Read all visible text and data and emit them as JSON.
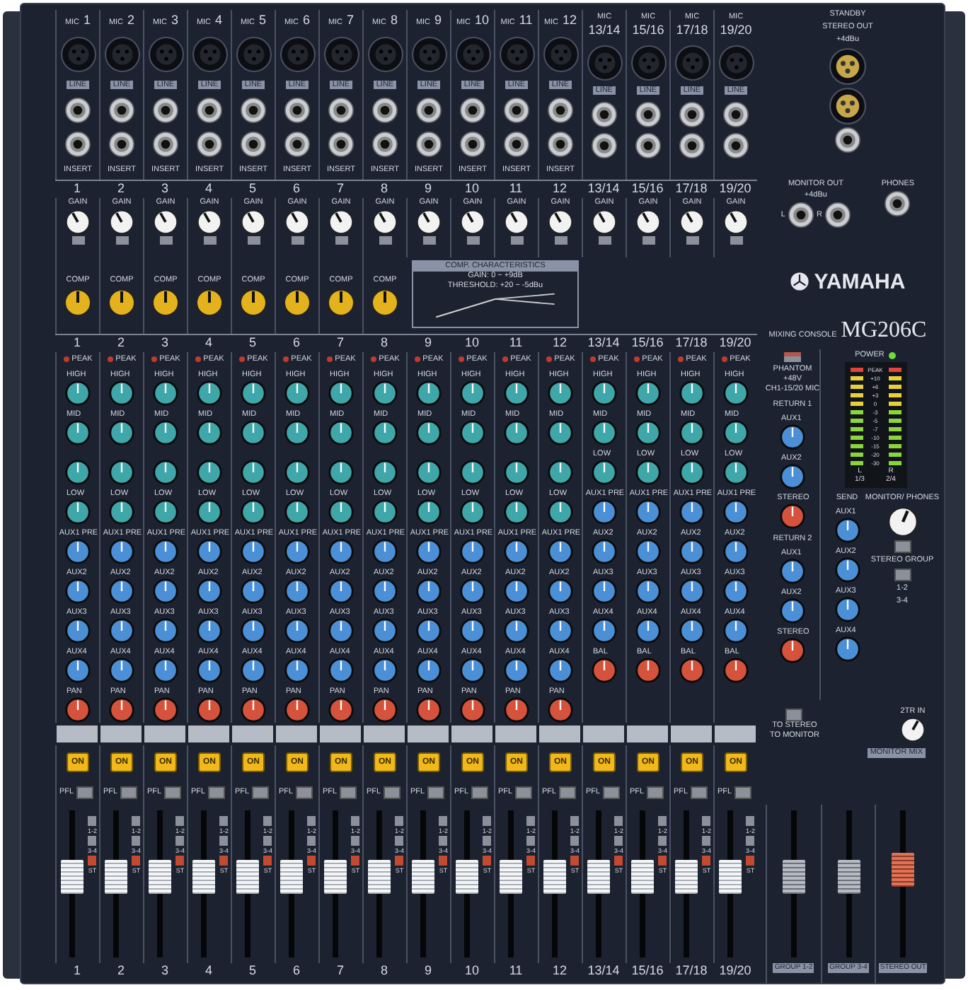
{
  "channels": [
    {
      "numbers": [
        "1",
        "1",
        "1",
        "1"
      ],
      "mic": "MIC",
      "line": "LINE",
      "insert": "INSERT",
      "gain": "GAIN",
      "comp": "COMP",
      "peak": "PEAK",
      "knobs": [
        {
          "label": "HIGH",
          "color": "#3fa6a9"
        },
        {
          "label": "MID",
          "color": "#3fa6a9"
        },
        {
          "color": "#3fa6a9"
        },
        {
          "label": "LOW",
          "color": "#3fa6a9"
        },
        {
          "label": "AUX1 PRE",
          "color": "#4b8fd6"
        },
        {
          "label": "AUX2",
          "color": "#4b8fd6"
        },
        {
          "label": "AUX3",
          "color": "#4b8fd6"
        },
        {
          "label": "AUX4",
          "color": "#4b8fd6"
        },
        {
          "label": "PAN",
          "color": "#d5523c"
        }
      ],
      "on": "ON",
      "pfl": "PFL",
      "assign": [
        "1-2",
        "3-4",
        "ST"
      ],
      "level": 0.56
    },
    {
      "numbers": [
        "2",
        "2",
        "2",
        "2"
      ],
      "mic": "MIC",
      "line": "LINE",
      "insert": "INSERT",
      "gain": "GAIN",
      "comp": "COMP",
      "peak": "PEAK",
      "knobs": [
        {
          "label": "HIGH",
          "color": "#3fa6a9"
        },
        {
          "label": "MID",
          "color": "#3fa6a9"
        },
        {
          "color": "#3fa6a9"
        },
        {
          "label": "LOW",
          "color": "#3fa6a9"
        },
        {
          "label": "AUX1 PRE",
          "color": "#4b8fd6"
        },
        {
          "label": "AUX2",
          "color": "#4b8fd6"
        },
        {
          "label": "AUX3",
          "color": "#4b8fd6"
        },
        {
          "label": "AUX4",
          "color": "#4b8fd6"
        },
        {
          "label": "PAN",
          "color": "#d5523c"
        }
      ],
      "on": "ON",
      "pfl": "PFL",
      "assign": [
        "1-2",
        "3-4",
        "ST"
      ],
      "level": 0.56
    },
    {
      "numbers": [
        "3",
        "3",
        "3",
        "3"
      ],
      "mic": "MIC",
      "line": "LINE",
      "insert": "INSERT",
      "gain": "GAIN",
      "comp": "COMP",
      "peak": "PEAK",
      "knobs": [
        {
          "label": "HIGH",
          "color": "#3fa6a9"
        },
        {
          "label": "MID",
          "color": "#3fa6a9"
        },
        {
          "color": "#3fa6a9"
        },
        {
          "label": "LOW",
          "color": "#3fa6a9"
        },
        {
          "label": "AUX1 PRE",
          "color": "#4b8fd6"
        },
        {
          "label": "AUX2",
          "color": "#4b8fd6"
        },
        {
          "label": "AUX3",
          "color": "#4b8fd6"
        },
        {
          "label": "AUX4",
          "color": "#4b8fd6"
        },
        {
          "label": "PAN",
          "color": "#d5523c"
        }
      ],
      "on": "ON",
      "pfl": "PFL",
      "assign": [
        "1-2",
        "3-4",
        "ST"
      ],
      "level": 0.56
    },
    {
      "numbers": [
        "4",
        "4",
        "4",
        "4"
      ],
      "mic": "MIC",
      "line": "LINE",
      "insert": "INSERT",
      "gain": "GAIN",
      "comp": "COMP",
      "peak": "PEAK",
      "knobs": [
        {
          "label": "HIGH",
          "color": "#3fa6a9"
        },
        {
          "label": "MID",
          "color": "#3fa6a9"
        },
        {
          "color": "#3fa6a9"
        },
        {
          "label": "LOW",
          "color": "#3fa6a9"
        },
        {
          "label": "AUX1 PRE",
          "color": "#4b8fd6"
        },
        {
          "label": "AUX2",
          "color": "#4b8fd6"
        },
        {
          "label": "AUX3",
          "color": "#4b8fd6"
        },
        {
          "label": "AUX4",
          "color": "#4b8fd6"
        },
        {
          "label": "PAN",
          "color": "#d5523c"
        }
      ],
      "on": "ON",
      "pfl": "PFL",
      "assign": [
        "1-2",
        "3-4",
        "ST"
      ],
      "level": 0.56
    },
    {
      "numbers": [
        "5",
        "5",
        "5",
        "5"
      ],
      "mic": "MIC",
      "line": "LINE",
      "insert": "INSERT",
      "gain": "GAIN",
      "comp": "COMP",
      "peak": "PEAK",
      "knobs": [
        {
          "label": "HIGH",
          "color": "#3fa6a9"
        },
        {
          "label": "MID",
          "color": "#3fa6a9"
        },
        {
          "color": "#3fa6a9"
        },
        {
          "label": "LOW",
          "color": "#3fa6a9"
        },
        {
          "label": "AUX1 PRE",
          "color": "#4b8fd6"
        },
        {
          "label": "AUX2",
          "color": "#4b8fd6"
        },
        {
          "label": "AUX3",
          "color": "#4b8fd6"
        },
        {
          "label": "AUX4",
          "color": "#4b8fd6"
        },
        {
          "label": "PAN",
          "color": "#d5523c"
        }
      ],
      "on": "ON",
      "pfl": "PFL",
      "assign": [
        "1-2",
        "3-4",
        "ST"
      ],
      "level": 0.56
    },
    {
      "numbers": [
        "6",
        "6",
        "6",
        "6"
      ],
      "mic": "MIC",
      "line": "LINE",
      "insert": "INSERT",
      "gain": "GAIN",
      "comp": "COMP",
      "peak": "PEAK",
      "knobs": [
        {
          "label": "HIGH",
          "color": "#3fa6a9"
        },
        {
          "label": "MID",
          "color": "#3fa6a9"
        },
        {
          "color": "#3fa6a9"
        },
        {
          "label": "LOW",
          "color": "#3fa6a9"
        },
        {
          "label": "AUX1 PRE",
          "color": "#4b8fd6"
        },
        {
          "label": "AUX2",
          "color": "#4b8fd6"
        },
        {
          "label": "AUX3",
          "color": "#4b8fd6"
        },
        {
          "label": "AUX4",
          "color": "#4b8fd6"
        },
        {
          "label": "PAN",
          "color": "#d5523c"
        }
      ],
      "on": "ON",
      "pfl": "PFL",
      "assign": [
        "1-2",
        "3-4",
        "ST"
      ],
      "level": 0.56
    },
    {
      "numbers": [
        "7",
        "7",
        "7",
        "7"
      ],
      "mic": "MIC",
      "line": "LINE",
      "insert": "INSERT",
      "gain": "GAIN",
      "comp": "COMP",
      "peak": "PEAK",
      "knobs": [
        {
          "label": "HIGH",
          "color": "#3fa6a9"
        },
        {
          "label": "MID",
          "color": "#3fa6a9"
        },
        {
          "color": "#3fa6a9"
        },
        {
          "label": "LOW",
          "color": "#3fa6a9"
        },
        {
          "label": "AUX1 PRE",
          "color": "#4b8fd6"
        },
        {
          "label": "AUX2",
          "color": "#4b8fd6"
        },
        {
          "label": "AUX3",
          "color": "#4b8fd6"
        },
        {
          "label": "AUX4",
          "color": "#4b8fd6"
        },
        {
          "label": "PAN",
          "color": "#d5523c"
        }
      ],
      "on": "ON",
      "pfl": "PFL",
      "assign": [
        "1-2",
        "3-4",
        "ST"
      ],
      "level": 0.56
    },
    {
      "numbers": [
        "8",
        "8",
        "8",
        "8"
      ],
      "mic": "MIC",
      "line": "LINE",
      "insert": "INSERT",
      "gain": "GAIN",
      "comp": "COMP",
      "peak": "PEAK",
      "knobs": [
        {
          "label": "HIGH",
          "color": "#3fa6a9"
        },
        {
          "label": "MID",
          "color": "#3fa6a9"
        },
        {
          "color": "#3fa6a9"
        },
        {
          "label": "LOW",
          "color": "#3fa6a9"
        },
        {
          "label": "AUX1 PRE",
          "color": "#4b8fd6"
        },
        {
          "label": "AUX2",
          "color": "#4b8fd6"
        },
        {
          "label": "AUX3",
          "color": "#4b8fd6"
        },
        {
          "label": "AUX4",
          "color": "#4b8fd6"
        },
        {
          "label": "PAN",
          "color": "#d5523c"
        }
      ],
      "on": "ON",
      "pfl": "PFL",
      "assign": [
        "1-2",
        "3-4",
        "ST"
      ],
      "level": 0.56
    },
    {
      "numbers": [
        "9",
        "9",
        "9",
        "9"
      ],
      "mic": "MIC",
      "line": "LINE",
      "insert": "INSERT",
      "gain": "GAIN",
      "peak": "PEAK",
      "knobs": [
        {
          "label": "HIGH",
          "color": "#3fa6a9"
        },
        {
          "label": "MID",
          "color": "#3fa6a9"
        },
        {
          "color": "#3fa6a9"
        },
        {
          "label": "LOW",
          "color": "#3fa6a9"
        },
        {
          "label": "AUX1 PRE",
          "color": "#4b8fd6"
        },
        {
          "label": "AUX2",
          "color": "#4b8fd6"
        },
        {
          "label": "AUX3",
          "color": "#4b8fd6"
        },
        {
          "label": "AUX4",
          "color": "#4b8fd6"
        },
        {
          "label": "PAN",
          "color": "#d5523c"
        }
      ],
      "on": "ON",
      "pfl": "PFL",
      "assign": [
        "1-2",
        "3-4",
        "ST"
      ],
      "level": 0.56
    },
    {
      "numbers": [
        "10",
        "10",
        "10",
        "10"
      ],
      "mic": "MIC",
      "line": "LINE",
      "insert": "INSERT",
      "gain": "GAIN",
      "peak": "PEAK",
      "knobs": [
        {
          "label": "HIGH",
          "color": "#3fa6a9"
        },
        {
          "label": "MID",
          "color": "#3fa6a9"
        },
        {
          "color": "#3fa6a9"
        },
        {
          "label": "LOW",
          "color": "#3fa6a9"
        },
        {
          "label": "AUX1 PRE",
          "color": "#4b8fd6"
        },
        {
          "label": "AUX2",
          "color": "#4b8fd6"
        },
        {
          "label": "AUX3",
          "color": "#4b8fd6"
        },
        {
          "label": "AUX4",
          "color": "#4b8fd6"
        },
        {
          "label": "PAN",
          "color": "#d5523c"
        }
      ],
      "on": "ON",
      "pfl": "PFL",
      "assign": [
        "1-2",
        "3-4",
        "ST"
      ],
      "level": 0.56
    },
    {
      "numbers": [
        "11",
        "11",
        "11",
        "11"
      ],
      "mic": "MIC",
      "line": "LINE",
      "insert": "INSERT",
      "gain": "GAIN",
      "peak": "PEAK",
      "knobs": [
        {
          "label": "HIGH",
          "color": "#3fa6a9"
        },
        {
          "label": "MID",
          "color": "#3fa6a9"
        },
        {
          "color": "#3fa6a9"
        },
        {
          "label": "LOW",
          "color": "#3fa6a9"
        },
        {
          "label": "AUX1 PRE",
          "color": "#4b8fd6"
        },
        {
          "label": "AUX2",
          "color": "#4b8fd6"
        },
        {
          "label": "AUX3",
          "color": "#4b8fd6"
        },
        {
          "label": "AUX4",
          "color": "#4b8fd6"
        },
        {
          "label": "PAN",
          "color": "#d5523c"
        }
      ],
      "on": "ON",
      "pfl": "PFL",
      "assign": [
        "1-2",
        "3-4",
        "ST"
      ],
      "level": 0.56
    },
    {
      "numbers": [
        "12",
        "12",
        "12",
        "12"
      ],
      "mic": "MIC",
      "line": "LINE",
      "insert": "INSERT",
      "gain": "GAIN",
      "peak": "PEAK",
      "knobs": [
        {
          "label": "HIGH",
          "color": "#3fa6a9"
        },
        {
          "label": "MID",
          "color": "#3fa6a9"
        },
        {
          "color": "#3fa6a9"
        },
        {
          "label": "LOW",
          "color": "#3fa6a9"
        },
        {
          "label": "AUX1 PRE",
          "color": "#4b8fd6"
        },
        {
          "label": "AUX2",
          "color": "#4b8fd6"
        },
        {
          "label": "AUX3",
          "color": "#4b8fd6"
        },
        {
          "label": "AUX4",
          "color": "#4b8fd6"
        },
        {
          "label": "PAN",
          "color": "#d5523c"
        }
      ],
      "on": "ON",
      "pfl": "PFL",
      "assign": [
        "1-2",
        "3-4",
        "ST"
      ],
      "level": 0.56
    },
    {
      "numbers": [
        "13/14",
        "13/14",
        "13/14",
        "13/14"
      ],
      "mic": "MIC",
      "line": "LINE",
      "gain": "GAIN",
      "peak": "PEAK",
      "knobs": [
        {
          "label": "HIGH",
          "color": "#3fa6a9"
        },
        {
          "label": "MID",
          "color": "#3fa6a9"
        },
        {
          "label": "LOW",
          "color": "#3fa6a9"
        },
        {
          "label": "AUX1 PRE",
          "color": "#4b8fd6"
        },
        {
          "label": "AUX2",
          "color": "#4b8fd6"
        },
        {
          "label": "AUX3",
          "color": "#4b8fd6"
        },
        {
          "label": "AUX4",
          "color": "#4b8fd6"
        },
        {
          "label": "BAL",
          "color": "#d5523c"
        }
      ],
      "on": "ON",
      "pfl": "PFL",
      "assign": [
        "1-2",
        "3-4",
        "ST"
      ],
      "level": 0.56
    },
    {
      "numbers": [
        "15/16",
        "15/16",
        "15/16",
        "15/16"
      ],
      "mic": "MIC",
      "line": "LINE",
      "gain": "GAIN",
      "peak": "PEAK",
      "knobs": [
        {
          "label": "HIGH",
          "color": "#3fa6a9"
        },
        {
          "label": "MID",
          "color": "#3fa6a9"
        },
        {
          "label": "LOW",
          "color": "#3fa6a9"
        },
        {
          "label": "AUX1 PRE",
          "color": "#4b8fd6"
        },
        {
          "label": "AUX2",
          "color": "#4b8fd6"
        },
        {
          "label": "AUX3",
          "color": "#4b8fd6"
        },
        {
          "label": "AUX4",
          "color": "#4b8fd6"
        },
        {
          "label": "BAL",
          "color": "#d5523c"
        }
      ],
      "on": "ON",
      "pfl": "PFL",
      "assign": [
        "1-2",
        "3-4",
        "ST"
      ],
      "level": 0.56
    },
    {
      "numbers": [
        "17/18",
        "17/18",
        "17/18",
        "17/18"
      ],
      "mic": "MIC",
      "line": "LINE",
      "gain": "GAIN",
      "peak": "PEAK",
      "knobs": [
        {
          "label": "HIGH",
          "color": "#3fa6a9"
        },
        {
          "label": "MID",
          "color": "#3fa6a9"
        },
        {
          "label": "LOW",
          "color": "#3fa6a9"
        },
        {
          "label": "AUX1 PRE",
          "color": "#4b8fd6"
        },
        {
          "label": "AUX2",
          "color": "#4b8fd6"
        },
        {
          "label": "AUX3",
          "color": "#4b8fd6"
        },
        {
          "label": "AUX4",
          "color": "#4b8fd6"
        },
        {
          "label": "BAL",
          "color": "#d5523c"
        }
      ],
      "on": "ON",
      "pfl": "PFL",
      "assign": [
        "1-2",
        "3-4",
        "ST"
      ],
      "level": 0.56
    },
    {
      "numbers": [
        "19/20",
        "19/20",
        "19/20",
        "19/20"
      ],
      "mic": "MIC",
      "line": "LINE",
      "gain": "GAIN",
      "peak": "PEAK",
      "knobs": [
        {
          "label": "HIGH",
          "color": "#3fa6a9"
        },
        {
          "label": "MID",
          "color": "#3fa6a9"
        },
        {
          "label": "LOW",
          "color": "#3fa6a9"
        },
        {
          "label": "AUX1 PRE",
          "color": "#4b8fd6"
        },
        {
          "label": "AUX2",
          "color": "#4b8fd6"
        },
        {
          "label": "AUX3",
          "color": "#4b8fd6"
        },
        {
          "label": "AUX4",
          "color": "#4b8fd6"
        },
        {
          "label": "BAL",
          "color": "#d5523c"
        }
      ],
      "on": "ON",
      "pfl": "PFL",
      "assign": [
        "1-2",
        "3-4",
        "ST"
      ],
      "level": 0.56
    }
  ],
  "gain_pads": [
    {
      "on": false
    },
    {
      "on": false
    },
    {
      "on": false
    },
    {
      "on": false
    },
    {
      "on": false
    },
    {
      "on": false
    },
    {
      "on": false
    },
    {
      "on": false
    },
    {
      "on": false
    },
    {
      "on": false
    },
    {
      "on": false
    },
    {
      "on": false
    },
    {
      "on": false
    },
    {
      "on": false
    },
    {
      "on": false
    },
    {
      "on": false
    }
  ],
  "comp_box": {
    "title": "COMP. CHARACTERISTICS",
    "gain": "GAIN: 0 ~ +9dB",
    "threshold": "THRESHOLD: +20 ~ -5dBu"
  },
  "master": {
    "standby": "STANDBY",
    "stereo_out": "STEREO OUT",
    "stereo_out_note": "+4dBu",
    "monitor_out": {
      "title": "MONITOR OUT",
      "note": "+4dBu",
      "left": "L",
      "right": "R"
    },
    "phones": "PHONES",
    "brand": "YAMAHA",
    "model_label": "MIXING CONSOLE",
    "model": "MG206C",
    "phantom": {
      "label": "PHANTOM",
      "voltage": "+48V",
      "note": "CH1-15/20 MIC",
      "on": false
    },
    "power": "POWER",
    "meter": {
      "scale": [
        "PEAK",
        "+10",
        "+6",
        "+3",
        "0",
        "-3",
        "-5",
        "-7",
        "-10",
        "-15",
        "-20",
        "-30"
      ],
      "channels": [
        "L",
        "R"
      ],
      "groups": [
        "1/3",
        "2/4"
      ]
    },
    "returns": [
      {
        "title": "RETURN 1",
        "knobs": [
          {
            "label": "AUX1",
            "color": "#4b8fd6"
          },
          {
            "label": "AUX2",
            "color": "#4b8fd6"
          },
          {
            "label": "STEREO",
            "color": "#d5523c"
          }
        ]
      },
      {
        "title": "RETURN 2",
        "knobs": [
          {
            "label": "AUX1",
            "color": "#4b8fd6"
          },
          {
            "label": "AUX2",
            "color": "#4b8fd6"
          },
          {
            "label": "STEREO",
            "color": "#d5523c"
          }
        ]
      }
    ],
    "send": {
      "title": "SEND",
      "knobs": [
        {
          "label": "AUX1",
          "color": "#4b8fd6"
        },
        {
          "label": "AUX2",
          "color": "#4b8fd6"
        },
        {
          "label": "AUX3",
          "color": "#4b8fd6"
        },
        {
          "label": "AUX4",
          "color": "#4b8fd6"
        }
      ]
    },
    "monitor": {
      "title": "MONITOR/ PHONES",
      "group_button": "STEREO GROUP",
      "pair_top": "1-2",
      "pair_bottom": "3-4"
    },
    "two_track": {
      "title": "2TR IN",
      "to_stereo": "TO STEREO",
      "to_monitor": "TO MONITOR",
      "monitor_mix": "MONITOR MIX"
    },
    "faders": [
      {
        "kind": "group",
        "label": "GROUP 1-2",
        "level": 0.56
      },
      {
        "kind": "group",
        "label": "GROUP 3-4",
        "level": 0.56
      },
      {
        "kind": "stereo",
        "label": "STEREO OUT",
        "level": 0.62
      }
    ]
  }
}
